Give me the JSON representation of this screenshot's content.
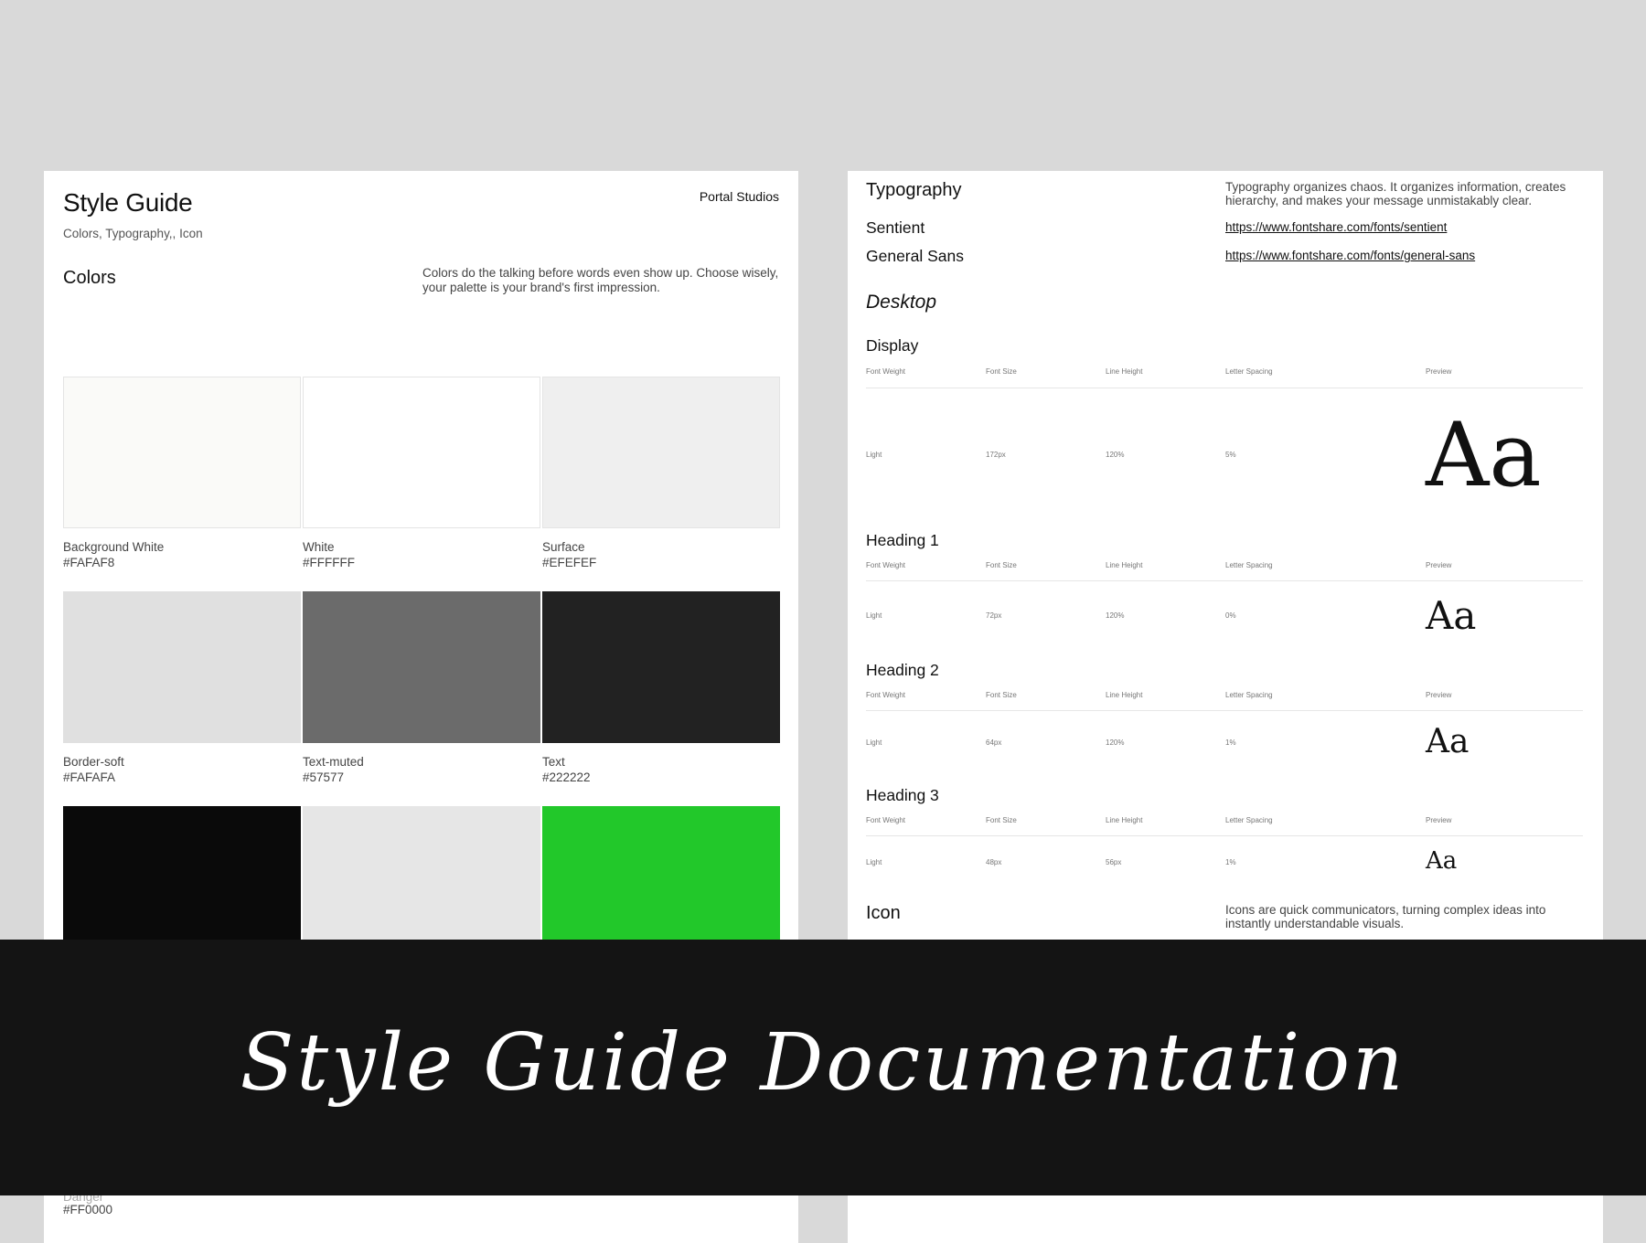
{
  "left_page": {
    "title": "Style Guide",
    "studio": "Portal Studios",
    "subtitle": "Colors, Typography,, Icon",
    "colors_heading": "Colors",
    "colors_description": "Colors do the talking before words even show up. Choose wisely, your palette is your brand's first impression.",
    "swatches": [
      {
        "name": "Background White",
        "hex": "#FAFAF8",
        "color": "#FAFAF8"
      },
      {
        "name": "White",
        "hex": "#FFFFFF",
        "color": "#FFFFFF"
      },
      {
        "name": "Surface",
        "hex": "#EFEFEF",
        "color": "#EFEFEF"
      },
      {
        "name": "Border-soft",
        "hex": "#FAFAFA",
        "color": "#E0E0E0"
      },
      {
        "name": "Text-muted",
        "hex": "#57577",
        "color": "#6B6B6B"
      },
      {
        "name": "Text",
        "hex": "#222222",
        "color": "#222222"
      },
      {
        "name": "",
        "hex": "",
        "color": "#0A0A0A"
      },
      {
        "name": "",
        "hex": "",
        "color": "#E6E6E6"
      },
      {
        "name": "",
        "hex": "",
        "color": "#22C82A"
      }
    ],
    "bottom_label_partial": "Danger",
    "bottom_hex": "#FF0000"
  },
  "right_page": {
    "typography_heading": "Typography",
    "typography_description": "Typography organizes chaos. It organizes information, creates hierarchy, and makes your message unmistakably clear.",
    "fonts": [
      {
        "name": "Sentient",
        "link": "https://www.fontshare.com/fonts/sentient"
      },
      {
        "name": "General Sans",
        "link": "https://www.fontshare.com/fonts/general-sans"
      }
    ],
    "desktop_label": "Desktop",
    "columns": [
      "Font Weight",
      "Font Size",
      "Line Height",
      "Letter Spacing",
      "Preview"
    ],
    "styles": [
      {
        "name": "Display",
        "weight": "Light",
        "size": "172px",
        "line_height": "120%",
        "letter_spacing": "5%",
        "preview": "Aa"
      },
      {
        "name": "Heading 1",
        "weight": "Light",
        "size": "72px",
        "line_height": "120%",
        "letter_spacing": "0%",
        "preview": "Aa"
      },
      {
        "name": "Heading 2",
        "weight": "Light",
        "size": "64px",
        "line_height": "120%",
        "letter_spacing": "1%",
        "preview": "Aa"
      },
      {
        "name": "Heading 3",
        "weight": "Light",
        "size": "48px",
        "line_height": "56px",
        "letter_spacing": "1%",
        "preview": "Aa"
      }
    ],
    "icon_heading": "Icon",
    "icon_description": "Icons are quick communicators, turning complex ideas into instantly understandable visuals."
  },
  "banner": {
    "title": "Style Guide Documentation"
  }
}
